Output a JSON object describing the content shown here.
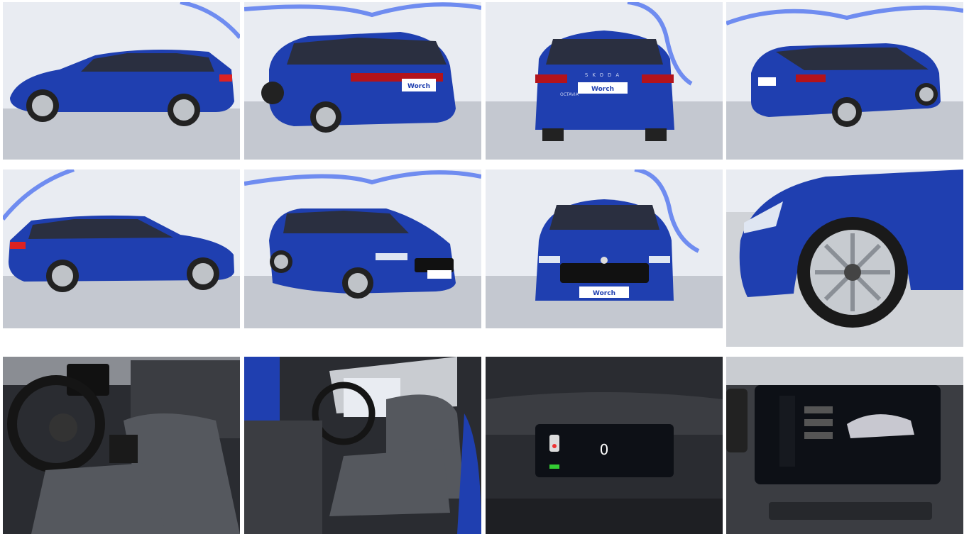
{
  "gallery": {
    "body_color": "#1f3fb0",
    "body_dark": "#142a80",
    "studio_light": "#e9ecf2",
    "studio_floor": "#c4c8d0",
    "neon_color": "#6f8cf0",
    "interior_dark": "#2a2c31",
    "interior_seat": "#55585e",
    "dealer_plate": "Worch",
    "rear_brand": "SKODA",
    "rear_model": "OCTAVIA",
    "cluster_speed": "0",
    "images": [
      {
        "view": "side-left"
      },
      {
        "view": "rear-left-three-quarter"
      },
      {
        "view": "rear"
      },
      {
        "view": "rear-right-three-quarter"
      },
      {
        "view": "side-right"
      },
      {
        "view": "front-left-three-quarter"
      },
      {
        "view": "front"
      },
      {
        "view": "front-wheel-detail"
      },
      {
        "view": "dashboard-driver"
      },
      {
        "view": "front-seats"
      },
      {
        "view": "instrument-cluster"
      },
      {
        "view": "infotainment-screen"
      }
    ]
  }
}
